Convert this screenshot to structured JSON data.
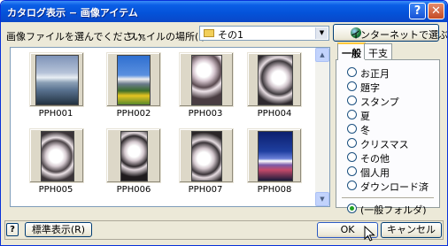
{
  "window": {
    "title": "カタログ表示 − 画像アイテム"
  },
  "toolbar": {
    "prompt": "画像ファイルを選んでください。",
    "location_label": "ファイルの場所(I):",
    "location_value": "その1",
    "internet_button": "インターネットで選ぶ(E)..."
  },
  "thumbnails": [
    {
      "name": "PPH001"
    },
    {
      "name": "PPH002"
    },
    {
      "name": "PPH003"
    },
    {
      "name": "PPH004"
    },
    {
      "name": "PPH005"
    },
    {
      "name": "PPH006"
    },
    {
      "name": "PPH007"
    },
    {
      "name": "PPH008"
    }
  ],
  "tabs": [
    {
      "label": "一般"
    },
    {
      "label": "干支"
    }
  ],
  "categories": [
    {
      "label": "お正月"
    },
    {
      "label": "題字"
    },
    {
      "label": "スタンプ"
    },
    {
      "label": "夏"
    },
    {
      "label": "冬"
    },
    {
      "label": "クリスマス"
    },
    {
      "label": "その他"
    },
    {
      "label": "個人用"
    },
    {
      "label": "ダウンロード済"
    }
  ],
  "general_folder": {
    "label": "(一般フォルダ)"
  },
  "footer": {
    "help_label": "?",
    "standard_view": "標準表示(R)",
    "ok": "OK",
    "cancel": "キャンセル"
  },
  "colors": {
    "title_bar": "#0452d8",
    "selected_radio": "#21a121",
    "active_tab": "#ffc83c"
  }
}
